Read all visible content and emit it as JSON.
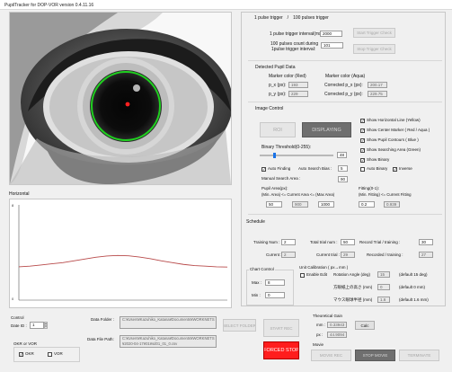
{
  "window": {
    "title": "PupilTracker for DOP-VOR version 0.4.11.16"
  },
  "trigger": {
    "header": "1 pulse trigger　/　100 pulses trigger",
    "interval_label": "1 pulse trigger interval(ms):",
    "interval_value": "2000",
    "count_label1": "100 pulses count during",
    "count_label2": "1pulse trigger interval:",
    "count_value": "101",
    "start_button": "Start Trigger Check",
    "stop_button": "Stop Trigger Check"
  },
  "pupil": {
    "header": "Detected Pupil Data",
    "marker_red": "Marker color (Red)",
    "marker_aqua": "Marker color (Aqua)",
    "px_label": "p_x (px):",
    "px_value": "193",
    "py_label": "p_y (px):",
    "py_value": "229",
    "cpx_label": "Corrected p_x (px):",
    "cpx_value": "200.17",
    "cpy_label": "Corrected p_y (px):",
    "cpy_value": "229.75"
  },
  "image_control": {
    "header": "Image Control",
    "roi_button": "ROI",
    "display_button": "DISPLAYING",
    "show_horizontal": "Show Horizontal Line (Yellow)",
    "show_center": "Show Center Marker ( Red / Aqua )",
    "show_contours": "Show Pupil Contours ( Blue )",
    "show_search": "Show Searching Area (Green)",
    "show_binary": "Show Binary",
    "threshold_label": "Binary Threshold(0-255):",
    "threshold_value": "48",
    "threshold_fraction": 0.19,
    "auto_finding": "Auto Finding",
    "auto_search_bias": "Auto Search Bias :",
    "bias_value": "5",
    "auto_binary": "Auto Binary",
    "inverse": "Inverse",
    "manual_search": "Manual Search Area :",
    "manual_value": "90",
    "pupil_area_label": "Pupil Area(px):",
    "fitting_label": "Fitting(0-1):",
    "area_row": "(Min. Area) <= Current Area <= (Max Area)",
    "fit_row": "(Min. Fitting) <= Current Fitting",
    "min_area": "50",
    "current_area": "900",
    "max_area": "1000",
    "min_fit": "0.2",
    "current_fit": "0.939"
  },
  "schedule": {
    "header": "Schedule",
    "training_num_label": "Training Num :",
    "training_num": "2",
    "total_trial_label": "Total trial num :",
    "total_trial": "50",
    "record_trial_training_label": "Record Trial / training :",
    "record_trial_training": "30",
    "current_label": "Current :",
    "current": "2",
    "current_trial_label": "Current trial :",
    "current_trial": "29",
    "recorded_training_label": "Recorded / training :",
    "recorded_training": "27"
  },
  "chart_control": {
    "header": "Chart Control",
    "max_label": "Max :",
    "max_value": "8",
    "min_label": "Min :",
    "min_value": "0"
  },
  "unit_cal": {
    "header": "Unit Calibration ( px→mm )",
    "enable_edit": "Enable Edit",
    "rotation_label": "Rotation Angle (deg)",
    "rotation_value": "15",
    "rotation_default": "(default 15 deg)",
    "vertical_label": "方眼紙上の高さ (mm)",
    "vertical_value": "0",
    "vertical_default": "(default 0 mm)",
    "eye_label": "マウス眼球半径 (mm)",
    "eye_value": "1.6",
    "eye_default": "(default 1.6 mm)"
  },
  "horizontal": {
    "header": "Horizontal"
  },
  "chart_data": {
    "type": "line",
    "title": "",
    "xlabel": "",
    "ylabel": "",
    "ylim": [
      0,
      8
    ],
    "y_tick_labels": [
      "8",
      "0"
    ],
    "series": [
      {
        "values": [
          2.8,
          2.85,
          2.95,
          3.05,
          3.15,
          3.3,
          3.45,
          3.6,
          3.7,
          3.75,
          3.72,
          3.62,
          3.48,
          3.3,
          3.15,
          3.0,
          2.9,
          2.85,
          2.8,
          2.78
        ]
      }
    ],
    "colors": {
      "line": "#b84a4a"
    },
    "grid": false
  },
  "control": {
    "header": "Control",
    "date_label": "Date ID :",
    "date_value": "1",
    "okr_vor_label": "OKR or VOR",
    "okr_label": "OKR",
    "vor_label": "VOR"
  },
  "data_folder": {
    "folder_label": "Data Folder :",
    "folder_value": "C:¥Users¥Kazuhiko_Katana¥Documents¥WORKNETS",
    "file_label": "Data File Path:",
    "file_value1": "C:¥Users¥Kazuhiko_Katana¥Documents¥WORKNETS",
    "file_value2": "¥2020-04-17¥01¥sd01_01_0.csv",
    "select_button": "SELECT FOLDER",
    "start_rec": "START REC",
    "forced_stop": "FORCED STOP"
  },
  "gain": {
    "header": "Theoretical Gain",
    "mm_label": "mm :",
    "mm_value": "0.33943",
    "calc_button": "Calc",
    "px_label": "px :",
    "px_value": "44.9094"
  },
  "movie": {
    "header": "Movie",
    "movie_rec": "MOVIE REC",
    "stop_movie": "STOP MOVIE",
    "terminate": "TERMINATE"
  }
}
